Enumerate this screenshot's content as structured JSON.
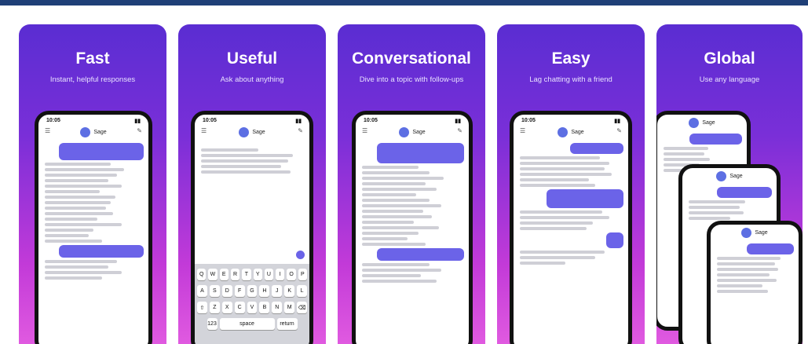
{
  "panels": [
    {
      "title": "Fast",
      "subtitle": "Instant, helpful responses"
    },
    {
      "title": "Useful",
      "subtitle": "Ask about anything"
    },
    {
      "title": "Conversational",
      "subtitle": "Dive into a topic with follow-ups"
    },
    {
      "title": "Easy",
      "subtitle": "Lag chatting with a friend"
    },
    {
      "title": "Global",
      "subtitle": "Use any language"
    }
  ],
  "phone": {
    "time": "10:05",
    "bot_name": "Sage"
  },
  "keyboard": {
    "row1": [
      "Q",
      "W",
      "E",
      "R",
      "T",
      "Y",
      "U",
      "I",
      "O",
      "P"
    ],
    "row2": [
      "A",
      "S",
      "D",
      "F",
      "G",
      "H",
      "J",
      "K",
      "L"
    ],
    "row3": [
      "Z",
      "X",
      "C",
      "V",
      "B",
      "N",
      "M"
    ],
    "space_label": "space",
    "return_label": "return"
  },
  "colors": {
    "topbar": "#1f3f77",
    "gradient_top": "#5a2dd2",
    "gradient_bottom": "#e05ae0",
    "bubble": "#6b63e8"
  }
}
